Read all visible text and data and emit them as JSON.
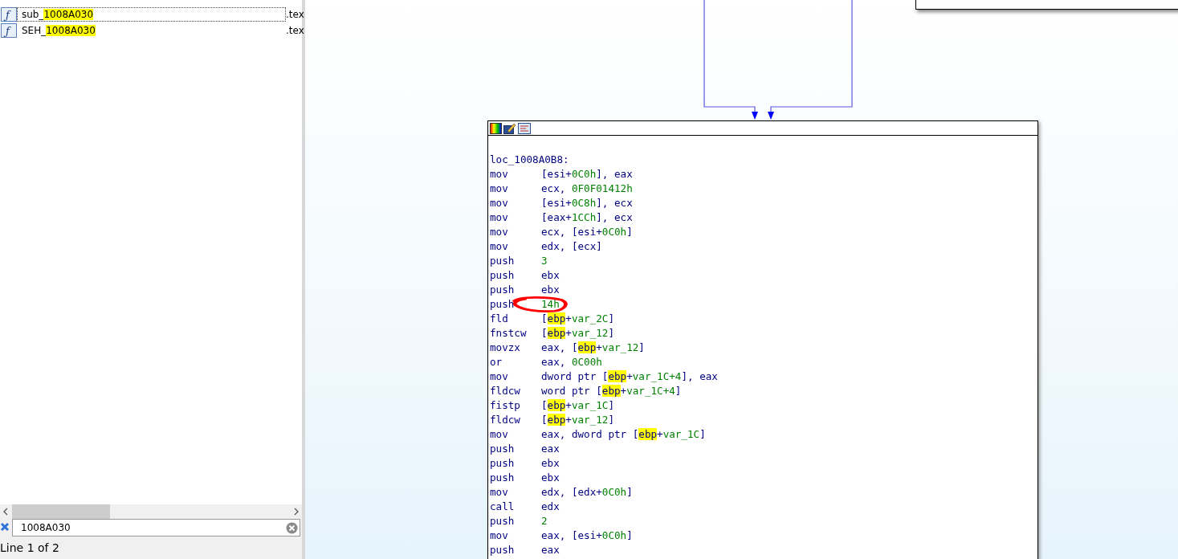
{
  "function_list": {
    "rows": [
      {
        "icon": "ƒ",
        "prefix": "sub_",
        "match": "1008A030",
        "segment": ".tex",
        "selected": true
      },
      {
        "icon": "ƒ",
        "prefix": "SEH_",
        "match": "1008A030",
        "segment": ".tex",
        "selected": false
      }
    ]
  },
  "search": {
    "value": "1008A030"
  },
  "status_bar": "Line 1 of 2",
  "graph": {
    "block": {
      "label": "loc_1008A0B8:",
      "lines": [
        {
          "op": "mov",
          "args": [
            {
              "t": "[esi+",
              "kind": "plain"
            },
            {
              "t": "0C0h",
              "kind": "number"
            },
            {
              "t": "], eax",
              "kind": "plain"
            }
          ]
        },
        {
          "op": "mov",
          "args": [
            {
              "t": "ecx, ",
              "kind": "plain"
            },
            {
              "t": "0F0F01412h",
              "kind": "number"
            }
          ]
        },
        {
          "op": "mov",
          "args": [
            {
              "t": "[esi+",
              "kind": "plain"
            },
            {
              "t": "0C8h",
              "kind": "number"
            },
            {
              "t": "], ecx",
              "kind": "plain"
            }
          ]
        },
        {
          "op": "mov",
          "args": [
            {
              "t": "[eax+",
              "kind": "plain"
            },
            {
              "t": "1CCh",
              "kind": "number"
            },
            {
              "t": "], ecx",
              "kind": "plain"
            }
          ]
        },
        {
          "op": "mov",
          "args": [
            {
              "t": "ecx, [esi+",
              "kind": "plain"
            },
            {
              "t": "0C0h",
              "kind": "number"
            },
            {
              "t": "]",
              "kind": "plain"
            }
          ]
        },
        {
          "op": "mov",
          "args": [
            {
              "t": "edx, [ecx]",
              "kind": "plain"
            }
          ]
        },
        {
          "op": "push",
          "args": [
            {
              "t": "3",
              "kind": "number"
            }
          ]
        },
        {
          "op": "push",
          "args": [
            {
              "t": "ebx",
              "kind": "plain"
            }
          ]
        },
        {
          "op": "push",
          "args": [
            {
              "t": "ebx",
              "kind": "plain"
            }
          ]
        },
        {
          "op": "push",
          "args": [
            {
              "t": "14h",
              "kind": "number"
            }
          ]
        },
        {
          "op": "fld",
          "args": [
            {
              "t": "[",
              "kind": "plain"
            },
            {
              "t": "ebp",
              "kind": "highlight"
            },
            {
              "t": "+",
              "kind": "plain"
            },
            {
              "t": "var_2C",
              "kind": "number"
            },
            {
              "t": "]",
              "kind": "plain"
            }
          ]
        },
        {
          "op": "fnstcw",
          "args": [
            {
              "t": "[",
              "kind": "plain"
            },
            {
              "t": "ebp",
              "kind": "highlight"
            },
            {
              "t": "+",
              "kind": "plain"
            },
            {
              "t": "var_12",
              "kind": "number"
            },
            {
              "t": "]",
              "kind": "plain"
            }
          ]
        },
        {
          "op": "movzx",
          "args": [
            {
              "t": "eax, [",
              "kind": "plain"
            },
            {
              "t": "ebp",
              "kind": "highlight"
            },
            {
              "t": "+",
              "kind": "plain"
            },
            {
              "t": "var_12",
              "kind": "number"
            },
            {
              "t": "]",
              "kind": "plain"
            }
          ]
        },
        {
          "op": "or",
          "args": [
            {
              "t": "eax, ",
              "kind": "plain"
            },
            {
              "t": "0C00h",
              "kind": "number"
            }
          ]
        },
        {
          "op": "mov",
          "args": [
            {
              "t": "dword ptr [",
              "kind": "plain"
            },
            {
              "t": "ebp",
              "kind": "highlight"
            },
            {
              "t": "+",
              "kind": "plain"
            },
            {
              "t": "var_1C+4",
              "kind": "number"
            },
            {
              "t": "], eax",
              "kind": "plain"
            }
          ]
        },
        {
          "op": "fldcw",
          "args": [
            {
              "t": "word ptr [",
              "kind": "plain"
            },
            {
              "t": "ebp",
              "kind": "highlight"
            },
            {
              "t": "+",
              "kind": "plain"
            },
            {
              "t": "var_1C+4",
              "kind": "number"
            },
            {
              "t": "]",
              "kind": "plain"
            }
          ]
        },
        {
          "op": "fistp",
          "args": [
            {
              "t": "[",
              "kind": "plain"
            },
            {
              "t": "ebp",
              "kind": "highlight"
            },
            {
              "t": "+",
              "kind": "plain"
            },
            {
              "t": "var_1C",
              "kind": "number"
            },
            {
              "t": "]",
              "kind": "plain"
            }
          ]
        },
        {
          "op": "fldcw",
          "args": [
            {
              "t": "[",
              "kind": "plain"
            },
            {
              "t": "ebp",
              "kind": "highlight"
            },
            {
              "t": "+",
              "kind": "plain"
            },
            {
              "t": "var_12",
              "kind": "number"
            },
            {
              "t": "]",
              "kind": "plain"
            }
          ]
        },
        {
          "op": "mov",
          "args": [
            {
              "t": "eax, dword ptr [",
              "kind": "plain"
            },
            {
              "t": "ebp",
              "kind": "highlight"
            },
            {
              "t": "+",
              "kind": "plain"
            },
            {
              "t": "var_1C",
              "kind": "number"
            },
            {
              "t": "]",
              "kind": "plain"
            }
          ]
        },
        {
          "op": "push",
          "args": [
            {
              "t": "eax",
              "kind": "plain"
            }
          ]
        },
        {
          "op": "push",
          "args": [
            {
              "t": "ebx",
              "kind": "plain"
            }
          ]
        },
        {
          "op": "push",
          "args": [
            {
              "t": "ebx",
              "kind": "plain"
            }
          ]
        },
        {
          "op": "mov",
          "args": [
            {
              "t": "edx, [edx+",
              "kind": "plain"
            },
            {
              "t": "0C0h",
              "kind": "number"
            },
            {
              "t": "]",
              "kind": "plain"
            }
          ]
        },
        {
          "op": "call",
          "args": [
            {
              "t": "edx",
              "kind": "plain"
            }
          ]
        },
        {
          "op": "push",
          "args": [
            {
              "t": "2",
              "kind": "number"
            }
          ]
        },
        {
          "op": "mov",
          "args": [
            {
              "t": "eax, [esi+",
              "kind": "plain"
            },
            {
              "t": "0C0h",
              "kind": "number"
            },
            {
              "t": "]",
              "kind": "plain"
            }
          ]
        },
        {
          "op": "push",
          "args": [
            {
              "t": "eax",
              "kind": "plain"
            }
          ]
        }
      ]
    }
  }
}
